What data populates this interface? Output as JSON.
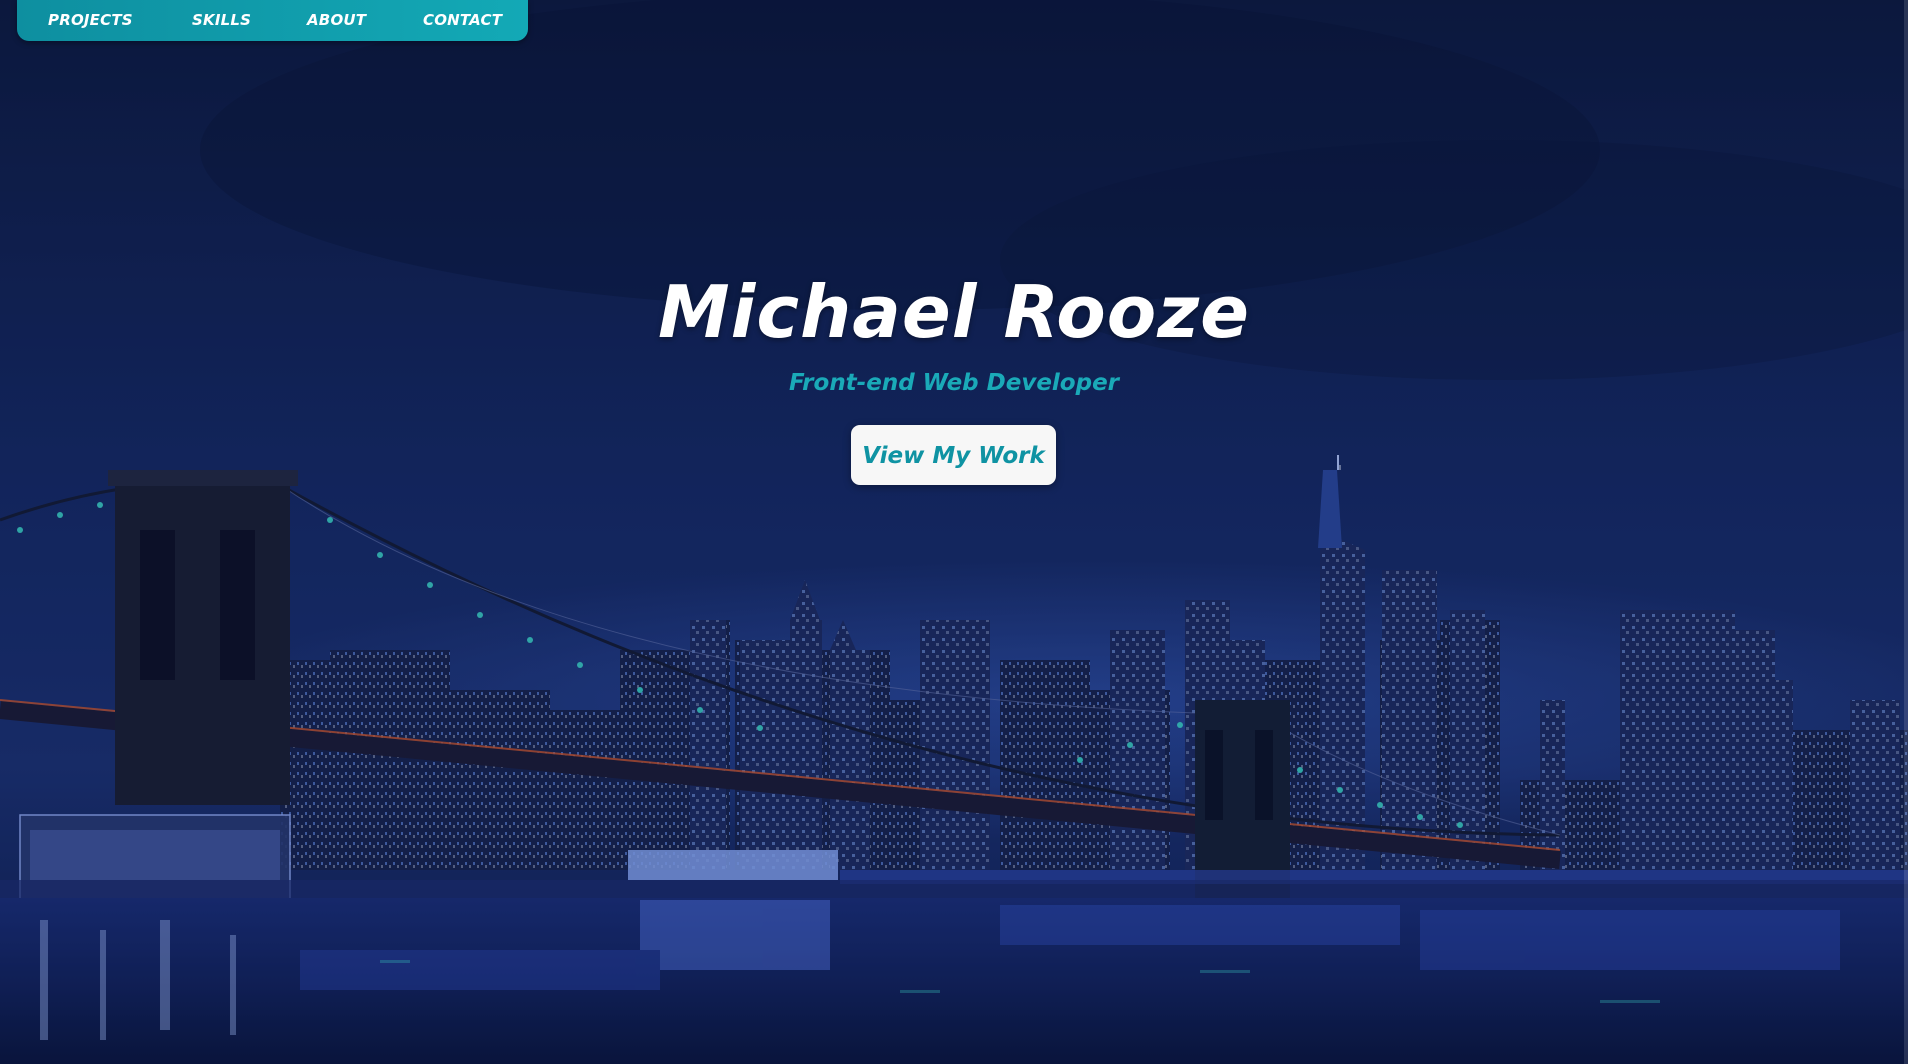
{
  "nav": {
    "items": [
      {
        "label": "PROJECTS"
      },
      {
        "label": "SKILLS"
      },
      {
        "label": "ABOUT"
      },
      {
        "label": "CONTACT"
      }
    ]
  },
  "hero": {
    "name": "Michael Rooze",
    "tagline": "Front-end Web Developer",
    "cta_label": "View My Work",
    "background": "night city skyline with suspension bridge over water"
  },
  "colors": {
    "accent": "#13a9b6",
    "cta_text": "#0f93a3",
    "cta_bg": "#f7f7f7",
    "sky": "#0f1e4a"
  }
}
